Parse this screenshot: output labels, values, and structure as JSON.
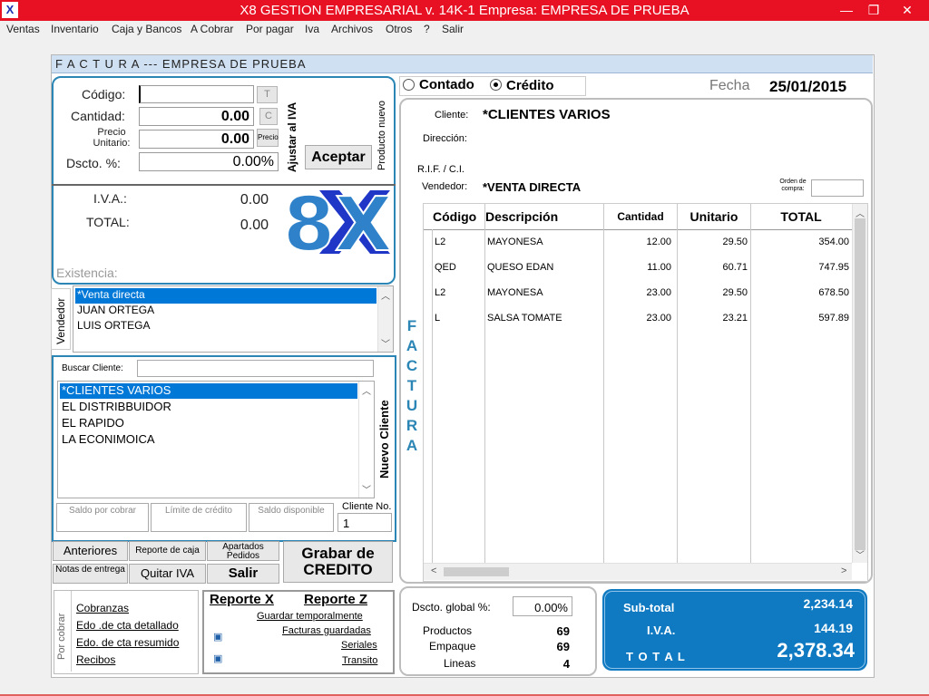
{
  "window": {
    "title": "X8 GESTION EMPRESARIAL v. 14K-1  Empresa: EMPRESA DE PRUEBA",
    "minimize": "—",
    "restore": "❐",
    "close": "✕"
  },
  "menu": [
    "Ventas",
    "Inventario",
    "Caja y Bancos",
    "A Cobrar",
    "Por pagar",
    "Iva",
    "Archivos",
    "Otros",
    "?",
    "Salir"
  ],
  "header": {
    "title": "F A C T U R A  ---  EMPRESA DE PRUEBA"
  },
  "entry": {
    "codigo_label": "Código:",
    "codigo_value": "",
    "t_btn": "T",
    "cantidad_label": "Cantidad:",
    "cantidad_value": "0.00",
    "c_btn": "C",
    "precio_label": "Precio Unitario:",
    "precio_value": "0.00",
    "precio_btn": "Precio",
    "dscto_label": "Dscto. %:",
    "dscto_value": "0.00%",
    "ajustar_iva": "Ajustar al IVA",
    "producto_nuevo": "Producto nuevo",
    "aceptar": "Aceptar"
  },
  "subtotals": {
    "iva_label": "I.V.A.:",
    "iva_value": "0.00",
    "total_label": "TOTAL:",
    "total_value": "0.00",
    "existencia": "Existencia:"
  },
  "vendedor": {
    "label": "Vendedor",
    "items": [
      "*Venta directa",
      "JUAN ORTEGA",
      "LUIS ORTEGA"
    ]
  },
  "cliente_panel": {
    "buscar_label": "Buscar Cliente:",
    "buscar_value": "",
    "items": [
      "*CLIENTES VARIOS",
      "EL DISTRIBBUIDOR",
      "EL RAPIDO",
      "LA ECONIMOICA"
    ],
    "nuevo_cliente": "Nuevo Cliente",
    "saldo_por_cobrar": "Saldo por cobrar",
    "limite_credito": "Límite de crédito",
    "saldo_disponible": "Saldo disponible",
    "cliente_no_label": "Cliente No.",
    "cliente_no_value": "1"
  },
  "actions": {
    "anteriores": "Anteriores",
    "reporte_caja": "Reporte de caja",
    "apartados": "Apartados Pedidos",
    "grabar": "Grabar de CREDITO",
    "notas_entrega": "Notas de entrega",
    "quitar_iva": "Quitar IVA",
    "salir": "Salir"
  },
  "por_cobrar": {
    "label": "Por cobrar",
    "links": [
      "Cobranzas",
      "Edo .de cta detallado",
      "Edo. de cta resumido",
      "Recibos"
    ]
  },
  "reportes": {
    "reporte_x": "Reporte X",
    "reporte_z": "Reporte Z",
    "guardar_temp": "Guardar temporalmente",
    "facturas_guardadas": "Facturas guardadas",
    "seriales": "Seriales",
    "transito": "Transito"
  },
  "payment": {
    "contado": "Contado",
    "credito": "Crédito",
    "selected": "Crédito",
    "fecha_label": "Fecha",
    "fecha_value": "25/01/2015"
  },
  "invoice": {
    "cliente_label": "Cliente:",
    "cliente_value": "*CLIENTES VARIOS",
    "direccion_label": "Dirección:",
    "direccion_value": "",
    "rif_label": "R.I.F. / C.I.",
    "rif_value": "",
    "vendedor_label": "Vendedor:",
    "vendedor_value": "*VENTA DIRECTA",
    "orden_label": "Orden de compra:",
    "orden_value": "",
    "side_label": "F A C T U R A",
    "columns": [
      "Código",
      "Descripción",
      "Cantidad",
      "Unitario",
      "TOTAL"
    ],
    "rows": [
      {
        "codigo": "L2",
        "desc": "MAYONESA",
        "cantidad": "12.00",
        "unitario": "29.50",
        "total": "354.00"
      },
      {
        "codigo": "QED",
        "desc": "QUESO EDAN",
        "cantidad": "11.00",
        "unitario": "60.71",
        "total": "747.95"
      },
      {
        "codigo": "L2",
        "desc": "MAYONESA",
        "cantidad": "23.00",
        "unitario": "29.50",
        "total": "678.50"
      },
      {
        "codigo": "L",
        "desc": "SALSA TOMATE",
        "cantidad": "23.00",
        "unitario": "23.21",
        "total": "597.89"
      }
    ]
  },
  "summary": {
    "dscto_global_label": "Dscto. global %:",
    "dscto_global_value": "0.00%",
    "productos_label": "Productos",
    "productos_value": "69",
    "empaque_label": "Empaque",
    "empaque_value": "69",
    "lineas_label": "Lineas",
    "lineas_value": "4"
  },
  "totals": {
    "subtotal_label": "Sub-total",
    "subtotal_value": "2,234.14",
    "iva_label": "I.V.A.",
    "iva_value": "144.19",
    "total_label": "T O T A L",
    "total_value": "2,378.34"
  },
  "logo_text": "8X",
  "colors": {
    "titlebar": "#e81123",
    "accent": "#2b86b5",
    "selection": "#0078d7",
    "totals_bg": "#0f7ac2"
  }
}
